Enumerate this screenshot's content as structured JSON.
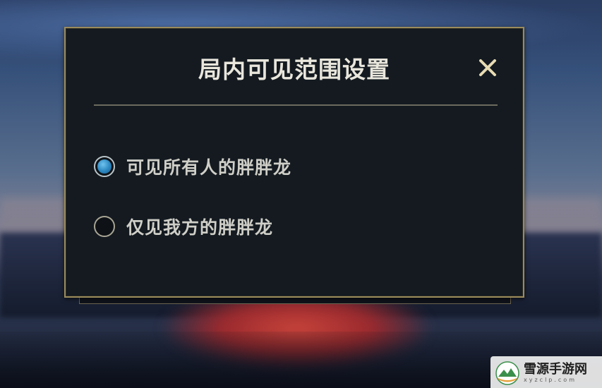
{
  "dialog": {
    "title": "局内可见范围设置",
    "close_icon": "close-icon",
    "options": [
      {
        "label": "可见所有人的胖胖龙",
        "selected": true
      },
      {
        "label": "仅见我方的胖胖龙",
        "selected": false
      }
    ]
  },
  "watermark": {
    "main": "雪源手游网",
    "sub": "xyzclp.com"
  },
  "colors": {
    "border_gold": "#9b8c5c",
    "panel_bg": "#141a20",
    "radio_selected": "#2b86bf",
    "close_icon": "#e8dcb4"
  }
}
